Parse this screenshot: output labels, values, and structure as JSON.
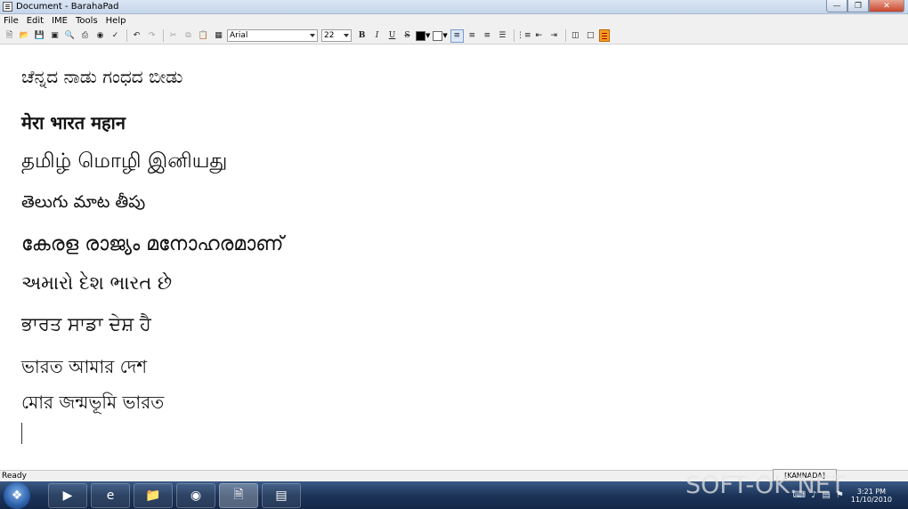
{
  "window": {
    "title": "Document - BarahaPad"
  },
  "menu": [
    "File",
    "Edit",
    "IME",
    "Tools",
    "Help"
  ],
  "toolbar": {
    "font": "Arial",
    "size": "22",
    "bold": "B",
    "italic": "I",
    "underline": "U",
    "strike": "S",
    "text_color": "#000000",
    "highlight_color": "#ffffff"
  },
  "document": {
    "lines": [
      "ಚೆನ್ನದ ನಾಡು ಗಂಧದ ಬೀಡು",
      "मेरा भारत महान",
      "தமிழ் மொழி இனியது",
      "తెలుగు మాట తీపు",
      "കേരള രാജ്യം മനോഹരമാണ്",
      "અમારો દેશ ભારત છે",
      "ਭਾਰਤ ਸਾਡਾ ਦੇਸ਼ ਹੈ",
      "ভারত আমার দেশ",
      "মোর জন্মভূমি ভারত"
    ]
  },
  "status": {
    "text": "Ready",
    "language": "[KANNADA]"
  },
  "taskbar": {
    "clock_time": "3:21 PM",
    "clock_date": "11/10/2010"
  },
  "watermark": "SOFT-OK.NET"
}
